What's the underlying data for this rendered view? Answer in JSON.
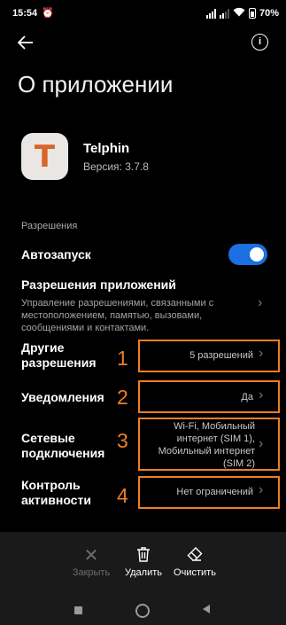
{
  "status_bar": {
    "time": "15:54",
    "alarm_icon": "alarm-icon",
    "battery": "70"
  },
  "header": {
    "title": "О приложении"
  },
  "app": {
    "name": "Telphin",
    "version": "Версия: 3.7.8",
    "icon_letter": "T"
  },
  "permissions": {
    "section_label": "Разрешения",
    "autostart": {
      "label": "Автозапуск",
      "enabled": true
    },
    "app_permissions": {
      "label": "Разрешения приложений",
      "description": "Управление разрешениями, связанными с местоположением, памятью, вызовами, сообщениями и контактами."
    },
    "other_permissions": {
      "label": "Другие разрешения",
      "value": "5 разрешений",
      "marker": "1"
    },
    "notifications": {
      "label": "Уведомления",
      "value": "Да",
      "marker": "2"
    },
    "network": {
      "label": "Сетевые подключения",
      "value": "Wi-Fi, Мобильный интернет (SIM 1), Мобильный интернет (SIM 2)",
      "marker": "3"
    },
    "activity": {
      "label": "Контроль активности",
      "value": "Нет ограничений",
      "marker": "4"
    }
  },
  "actions": {
    "close": "Закрыть",
    "delete": "Удалить",
    "clear": "Очистить"
  },
  "colors": {
    "accent": "#1b6fe0",
    "highlight": "#ee7e24",
    "app_icon_letter": "#d9652b"
  }
}
